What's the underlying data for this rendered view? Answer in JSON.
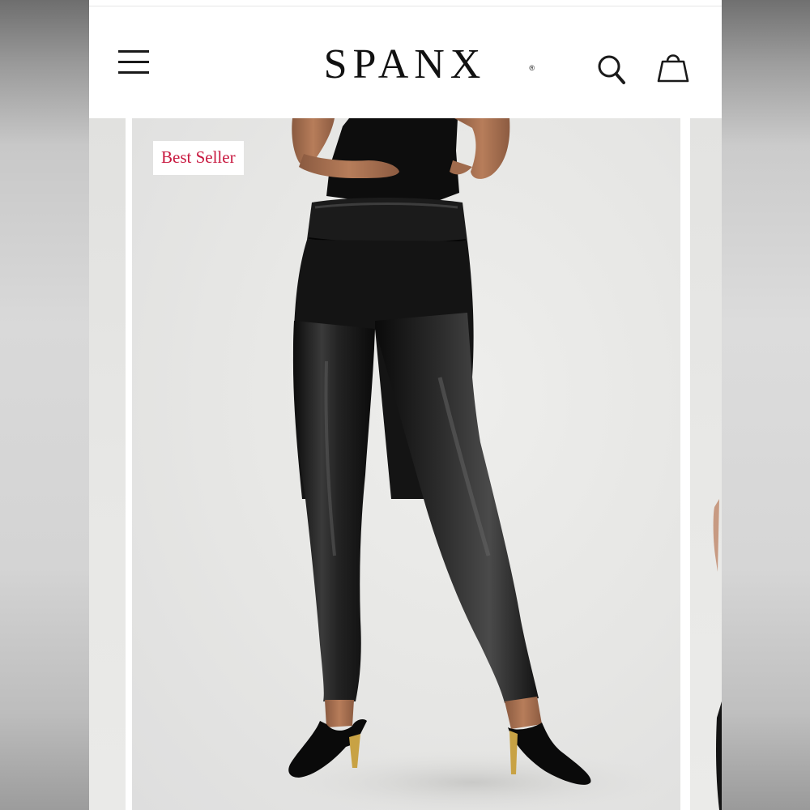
{
  "header": {
    "brand": "SPANX",
    "brand_mark": "®",
    "icons": {
      "menu": "hamburger-menu-icon",
      "search": "search-icon",
      "bag": "shopping-bag-icon"
    }
  },
  "product": {
    "badge_label": "Best Seller",
    "image": "black faux leather leggings worn with black kitten-heel pumps"
  },
  "colors": {
    "badge_text": "#c8183f",
    "header_bg": "#ffffff",
    "icon": "#1a1a1a"
  }
}
